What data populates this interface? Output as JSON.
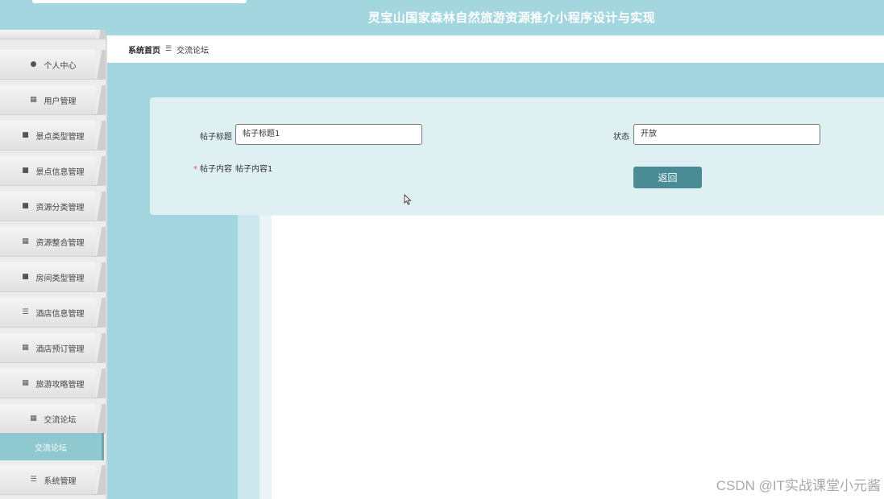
{
  "header": {
    "title": "灵宝山国家森林自然旅游资源推介小程序设计与实现"
  },
  "breadcrumb": {
    "home": "系统首页",
    "separator": "☰",
    "current": "交流论坛"
  },
  "sidebar": {
    "items": [
      {
        "icon": "person-icon",
        "glyph": "●",
        "label": "个人中心"
      },
      {
        "icon": "grid-icon",
        "glyph": "▦",
        "label": "用户管理"
      },
      {
        "icon": "book-icon",
        "glyph": "■",
        "label": "景点类型管理"
      },
      {
        "icon": "briefcase-icon",
        "glyph": "■",
        "label": "景点信息管理"
      },
      {
        "icon": "document-icon",
        "glyph": "■",
        "label": "资源分类管理"
      },
      {
        "icon": "grid-icon",
        "glyph": "▦",
        "label": "资源整合管理"
      },
      {
        "icon": "monitor-icon",
        "glyph": "■",
        "label": "房间类型管理"
      },
      {
        "icon": "list-icon",
        "glyph": "☰",
        "label": "酒店信息管理"
      },
      {
        "icon": "apps-icon",
        "glyph": "▦",
        "label": "酒店预订管理"
      },
      {
        "icon": "grid-icon",
        "glyph": "▦",
        "label": "旅游攻略管理"
      },
      {
        "icon": "grid-icon",
        "glyph": "▦",
        "label": "交流论坛"
      },
      {
        "icon": "menu-icon",
        "glyph": "☰",
        "label": "系统管理"
      }
    ],
    "active_sub": "交流论坛"
  },
  "form": {
    "title_label": "帖子标题",
    "title_value": "帖子标题1",
    "status_label": "状态",
    "status_value": "开放",
    "content_required_mark": "*",
    "content_label": "帖子内容",
    "content_value": "帖子内容1",
    "back_button": "返回"
  },
  "watermark": "CSDN @IT实战课堂小元酱",
  "colors": {
    "header": "#a3d6de",
    "button": "#4a8c95",
    "card": "#dff0f3",
    "sidebar_active": "#8fc8cf"
  }
}
